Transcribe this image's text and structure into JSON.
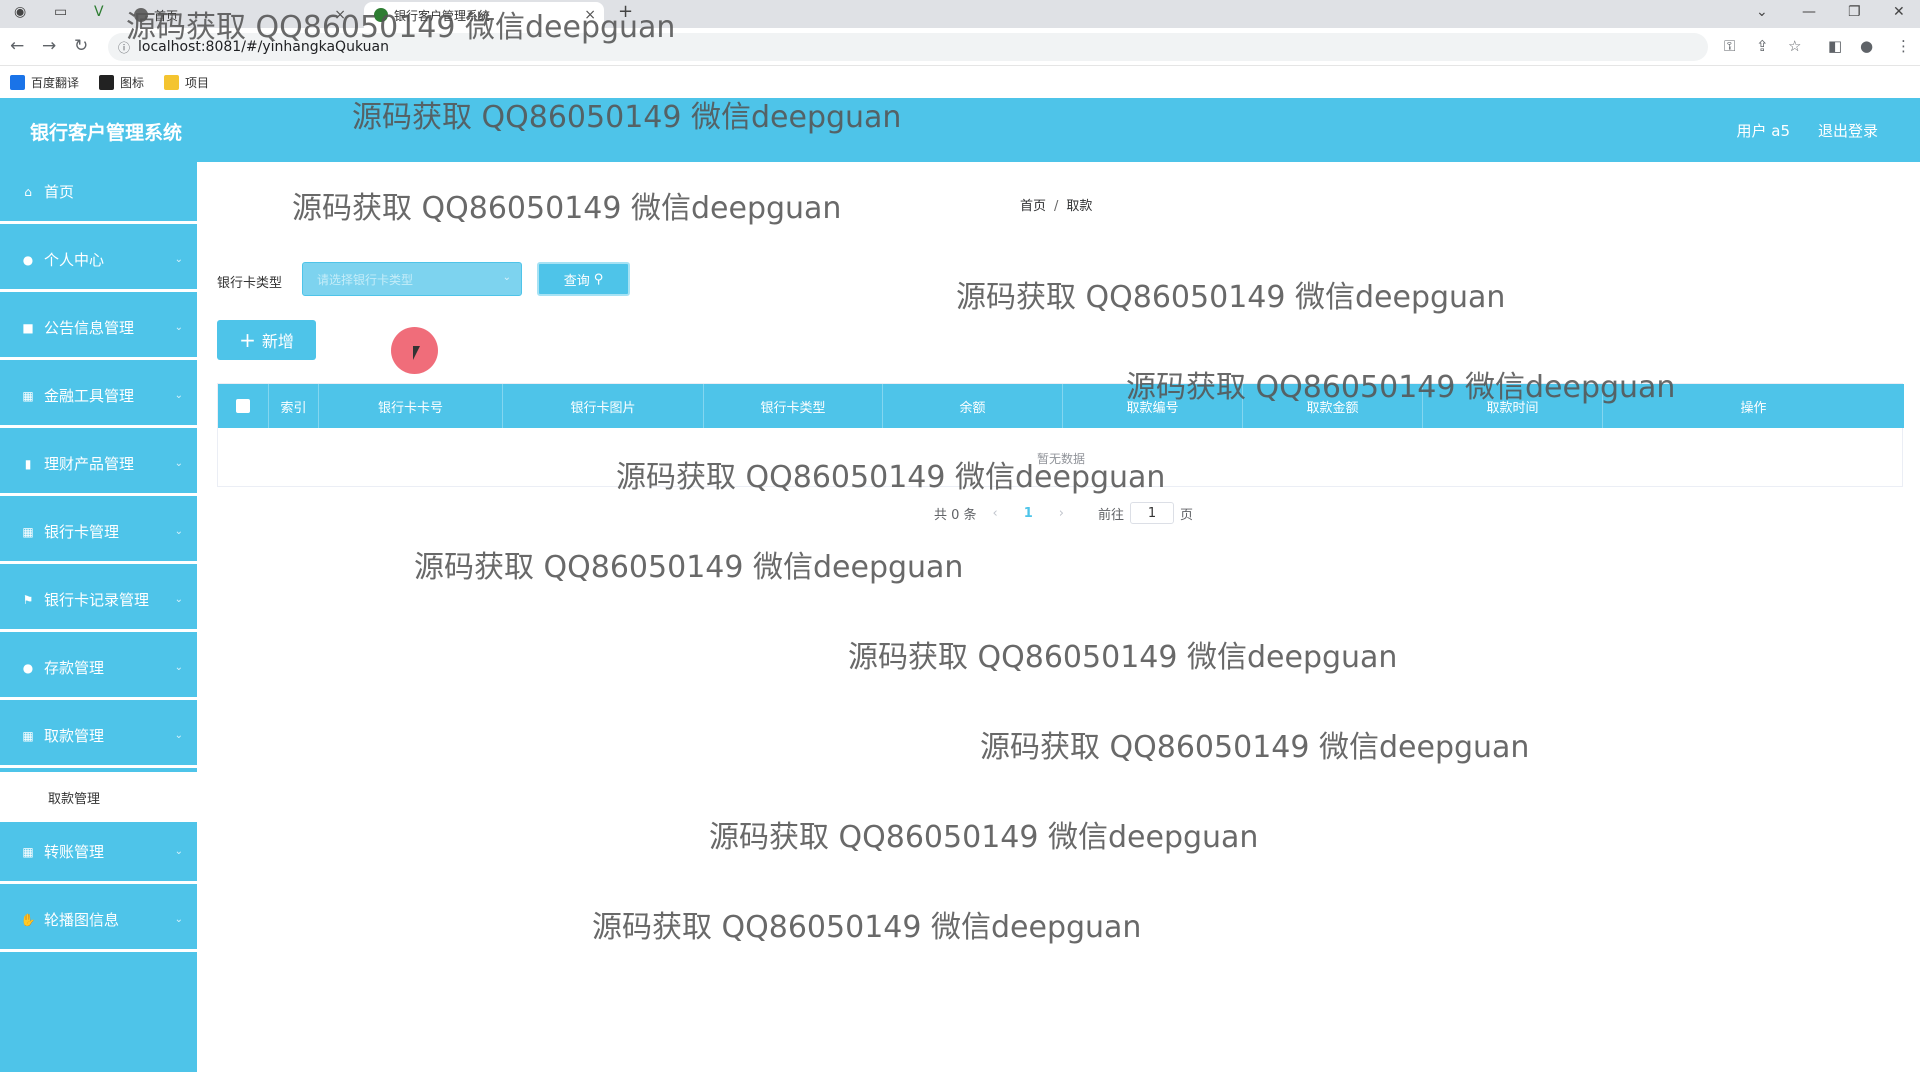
{
  "browser": {
    "tabs": [
      {
        "title": "首页"
      },
      {
        "title": "银行客户管理系统"
      }
    ],
    "url": "localhost:8081/#/yinhangkaQukuan",
    "bookmarks": [
      {
        "label": "百度翻译",
        "color": "#1a73e8"
      },
      {
        "label": "图标",
        "color": "#222222"
      },
      {
        "label": "项目",
        "color": "#f4c430"
      }
    ]
  },
  "header": {
    "title": "银行客户管理系统",
    "user": "用户 a5",
    "logout": "退出登录"
  },
  "sidebar": {
    "items": [
      {
        "label": "首页",
        "icon": "home-icon"
      },
      {
        "label": "个人中心",
        "icon": "user-icon"
      },
      {
        "label": "公告信息管理",
        "icon": "message-icon"
      },
      {
        "label": "金融工具管理",
        "icon": "grid-icon"
      },
      {
        "label": "理财产品管理",
        "icon": "bar-chart-icon"
      },
      {
        "label": "银行卡管理",
        "icon": "grid-icon"
      },
      {
        "label": "银行卡记录管理",
        "icon": "flag-icon"
      },
      {
        "label": "存款管理",
        "icon": "user-icon"
      },
      {
        "label": "取款管理",
        "icon": "grid-icon"
      },
      {
        "label": "转账管理",
        "icon": "grid-icon"
      },
      {
        "label": "轮播图信息",
        "icon": "thumb-icon"
      }
    ],
    "submenu_label": "取款管理"
  },
  "breadcrumb": {
    "home": "首页",
    "current": "取款"
  },
  "search": {
    "label": "银行卡类型",
    "placeholder": "请选择银行卡类型",
    "query_button": "查询"
  },
  "actions": {
    "add_button": "新增"
  },
  "table": {
    "columns": [
      "索引",
      "银行卡卡号",
      "银行卡图片",
      "银行卡类型",
      "余额",
      "取款编号",
      "取款金额",
      "取款时间",
      "操作"
    ],
    "empty_text": "暂无数据"
  },
  "pagination": {
    "total": "共 0 条",
    "current_page": "1",
    "goto_label": "前往",
    "goto_value": "1",
    "page_suffix": "页"
  },
  "watermark": "源码获取 QQ86050149 微信deepguan",
  "accent_color": "#4ec4e9"
}
